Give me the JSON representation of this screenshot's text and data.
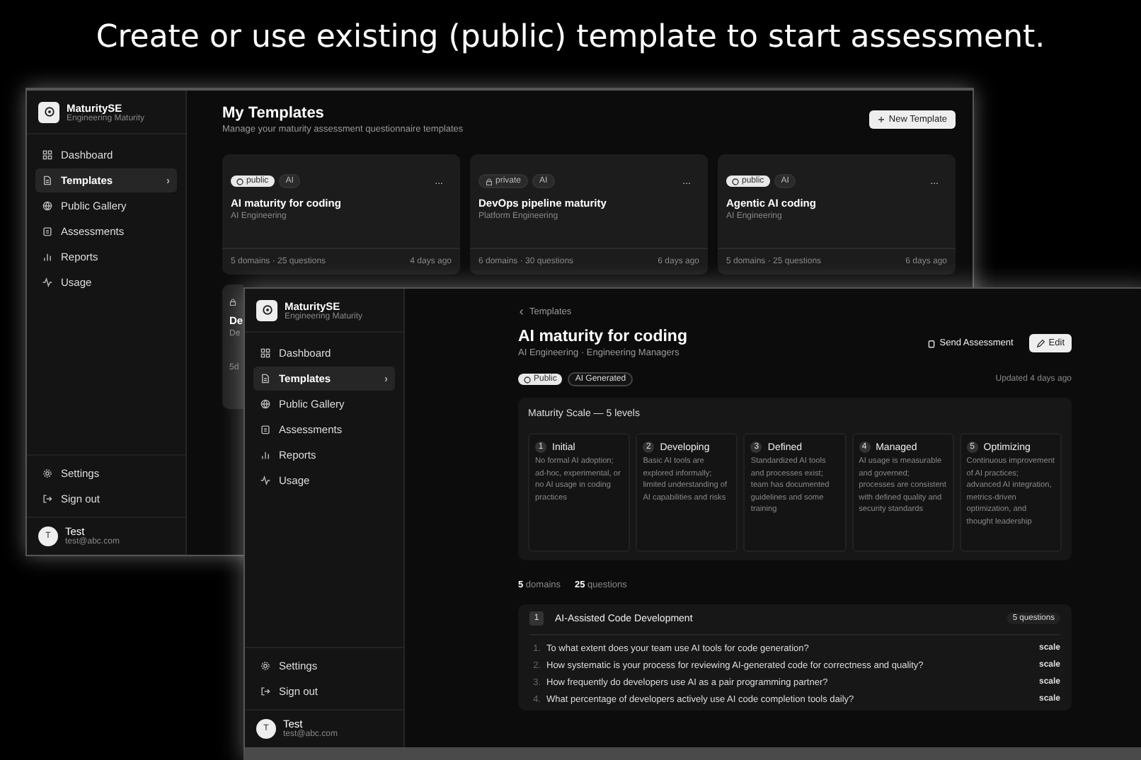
{
  "headline": "Create or use existing (public) template to start assessment.",
  "back_window": {
    "brand": {
      "name": "MaturitySE",
      "subtitle": "Engineering Maturity"
    },
    "nav": [
      {
        "label": "Dashboard",
        "selected": false
      },
      {
        "label": "Templates",
        "selected": true,
        "chevron": "›"
      },
      {
        "label": "Public Gallery",
        "selected": false
      },
      {
        "label": "Assessments",
        "selected": false
      },
      {
        "label": "Reports",
        "selected": false
      },
      {
        "label": "Usage",
        "selected": false
      }
    ],
    "footer_nav": [
      {
        "label": "Settings"
      },
      {
        "label": "Sign out"
      }
    ],
    "user": {
      "initial": "T",
      "name": "Test",
      "email": "test@abc.com"
    },
    "page": {
      "title": "My Templates",
      "subtitle": "Manage your maturity assessment questionnaire templates",
      "new_button": "New Template"
    },
    "cards": [
      {
        "visibility": {
          "kind": "public",
          "label": "public"
        },
        "tag": "AI",
        "menu": "...",
        "title": "AI maturity for coding",
        "subtitle": "AI Engineering",
        "stats": "5 domains · 25 questions",
        "updated": "4 days ago"
      },
      {
        "visibility": {
          "kind": "private",
          "label": "private"
        },
        "tag": "AI",
        "menu": "...",
        "title": "DevOps pipeline maturity",
        "subtitle": "Platform Engineering",
        "stats": "6 domains · 30 questions",
        "updated": "6 days ago"
      },
      {
        "visibility": {
          "kind": "public",
          "label": "public"
        },
        "tag": "AI",
        "menu": "...",
        "title": "Agentic AI coding",
        "subtitle": "AI Engineering",
        "stats": "5 domains · 25 questions",
        "updated": "6 days ago"
      }
    ],
    "partial_card": {
      "title": "De",
      "subtitle": "De",
      "stats": "5d"
    }
  },
  "front_window": {
    "brand": {
      "name": "MaturitySE",
      "subtitle": "Engineering Maturity"
    },
    "nav": [
      {
        "label": "Dashboard",
        "selected": false
      },
      {
        "label": "Templates",
        "selected": true,
        "chevron": "›"
      },
      {
        "label": "Public Gallery",
        "selected": false
      },
      {
        "label": "Assessments",
        "selected": false
      },
      {
        "label": "Reports",
        "selected": false
      },
      {
        "label": "Usage",
        "selected": false
      }
    ],
    "footer_nav": [
      {
        "label": "Settings"
      },
      {
        "label": "Sign out"
      }
    ],
    "user": {
      "initial": "T",
      "name": "Test",
      "email": "test@abc.com"
    },
    "breadcrumb": "Templates",
    "title": "AI maturity for coding",
    "subtitle": "AI Engineering · Engineering Managers",
    "actions": [
      {
        "label": "Send Assessment",
        "kind": "ghost"
      },
      {
        "label": "Edit",
        "kind": "primary"
      }
    ],
    "badges": [
      {
        "label": "Public",
        "kind": "public"
      },
      {
        "label": "AI Generated",
        "kind": "outline"
      }
    ],
    "updated": "Updated 4 days ago",
    "scale": {
      "title": "Maturity Scale — 5 levels",
      "levels": [
        {
          "number": "1",
          "name": "Initial",
          "description": "No formal AI adoption; ad-hoc, experimental, or no AI usage in coding practices"
        },
        {
          "number": "2",
          "name": "Developing",
          "description": "Basic AI tools are explored informally; limited understanding of AI capabilities and risks"
        },
        {
          "number": "3",
          "name": "Defined",
          "description": "Standardized AI tools and processes exist; team has documented guidelines and some training"
        },
        {
          "number": "4",
          "name": "Managed",
          "description": "AI usage is measurable and governed; processes are consistent with defined quality and security standards"
        },
        {
          "number": "5",
          "name": "Optimizing",
          "description": "Continuous improvement of AI practices; advanced AI integration, metrics-driven optimization, and thought leadership"
        }
      ]
    },
    "summary": {
      "domains_count": "5",
      "domains_label": "domains",
      "questions_count": "25",
      "questions_label": "questions"
    },
    "domain": {
      "number": "1",
      "title": "AI-Assisted Code Development",
      "count": "5 questions",
      "questions": [
        {
          "number": "1.",
          "text": "To what extent does your team use AI tools for code generation?",
          "type": "scale"
        },
        {
          "number": "2.",
          "text": "How systematic is your process for reviewing AI-generated code for correctness and quality?",
          "type": "scale"
        },
        {
          "number": "3.",
          "text": "How frequently do developers use AI as a pair programming partner?",
          "type": "scale"
        },
        {
          "number": "4.",
          "text": "What percentage of developers actively use AI code completion tools daily?",
          "type": "scale"
        }
      ]
    }
  }
}
